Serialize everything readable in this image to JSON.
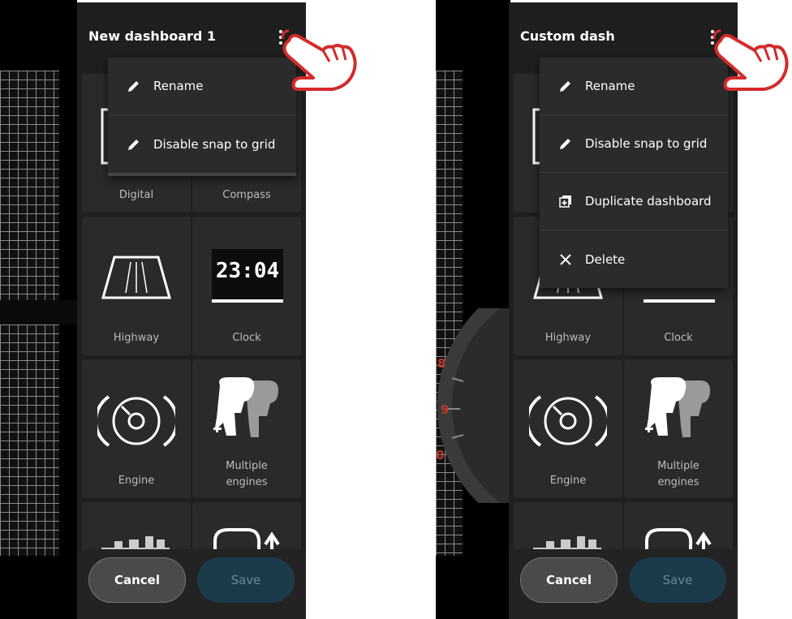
{
  "left_screen": {
    "title": "New dashboard 1",
    "menu": [
      {
        "label": "Rename",
        "icon": "pencil-icon"
      },
      {
        "label": "Disable snap to grid",
        "icon": "pencil-icon"
      }
    ]
  },
  "right_screen": {
    "title": "Custom dash",
    "menu": [
      {
        "label": "Rename",
        "icon": "pencil-icon"
      },
      {
        "label": "Disable snap to grid",
        "icon": "pencil-icon"
      },
      {
        "label": "Duplicate dashboard",
        "icon": "duplicate-icon"
      },
      {
        "label": "Delete",
        "icon": "close-icon"
      }
    ],
    "gauge_numbers": [
      "8",
      "9",
      "0"
    ]
  },
  "widgets": {
    "digital": "Digital",
    "compass": "Compass",
    "highway": "Highway",
    "clock": "Clock",
    "clock_readout": "23:04",
    "engine": "Engine",
    "multiple_engines": "Multiple engines"
  },
  "footer": {
    "cancel": "Cancel",
    "save": "Save"
  },
  "colors": {
    "panel_bg": "#1f1f1f",
    "tile_bg": "#2a2a2a",
    "menu_bg": "#2b2b2b",
    "save_bg": "#1b3a4a",
    "hand_red": "#d42a2a",
    "gauge_red": "#c0392b"
  }
}
